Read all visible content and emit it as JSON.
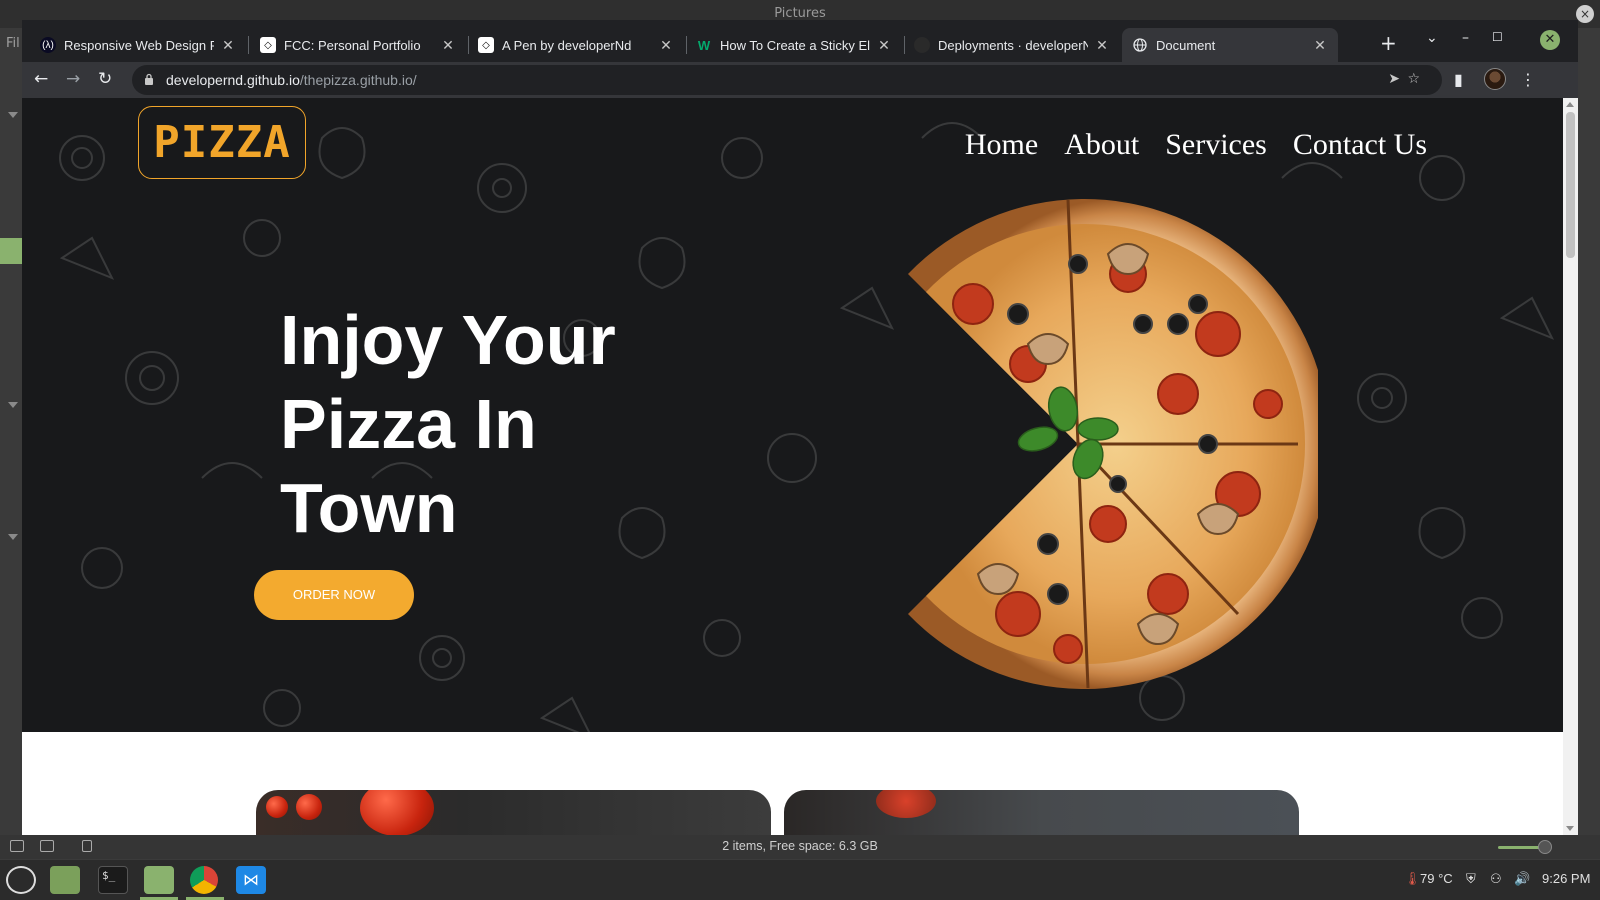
{
  "desktop": {
    "window_title": "Pictures",
    "side_label": "Fil"
  },
  "browser": {
    "tabs": [
      {
        "title": "Responsive Web Design Pr",
        "favicon": "freecodecamp-icon",
        "active": false
      },
      {
        "title": "FCC: Personal Portfolio",
        "favicon": "codepen-icon",
        "active": false
      },
      {
        "title": "A Pen by developerNd",
        "favicon": "codepen-icon",
        "active": false
      },
      {
        "title": "How To Create a Sticky Ele",
        "favicon": "w3schools-icon",
        "active": false
      },
      {
        "title": "Deployments · developerN",
        "favicon": "github-icon",
        "active": false
      },
      {
        "title": "Document",
        "favicon": "globe-icon",
        "active": true
      }
    ],
    "url_host": "developernd.github.io",
    "url_path": "/thepizza.github.io/"
  },
  "page": {
    "logo": "PIZZA",
    "nav": [
      "Home",
      "About",
      "Services",
      "Contact Us"
    ],
    "headline": "Injoy Your Pizza In Town",
    "cta": "ORDER NOW",
    "colors": {
      "accent": "#f3aa2f",
      "hero_bg": "#18191b",
      "text": "#ffffff"
    }
  },
  "file_manager": {
    "status": "2 items, Free space: 6.3 GB"
  },
  "taskbar": {
    "temperature": "79 °C",
    "clock": "9:26 PM"
  }
}
